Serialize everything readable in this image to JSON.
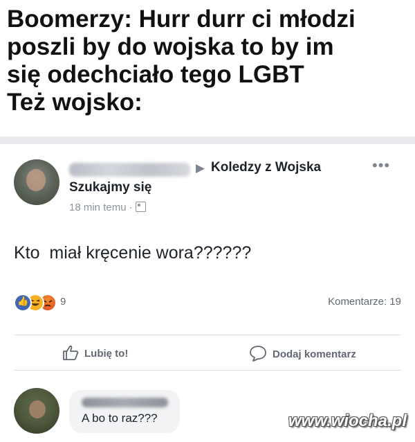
{
  "meme": {
    "caption_lines": [
      "Boomerzy: Hurr durr ci młodzi",
      "poszli by do wojska to by im",
      "się odechciało tego LGBT",
      "Też wojsko:"
    ]
  },
  "post": {
    "group_name": "Koledzy z Wojska",
    "feeling": "Szukajmy się",
    "timestamp": "18 min temu",
    "body": "Kto  miał kręcenie wora??????",
    "reaction_count": "9",
    "comment_count": "Komentarze: 19",
    "like_label": "Lubię to!",
    "comment_label": "Dodaj komentarz",
    "colors": {
      "like_blue": "#4267b2",
      "meta_gray": "#8d949e",
      "band": "#e9ebee"
    }
  },
  "comment": {
    "text": "A bo to raz???"
  },
  "watermark": "www.wiocha.pl"
}
